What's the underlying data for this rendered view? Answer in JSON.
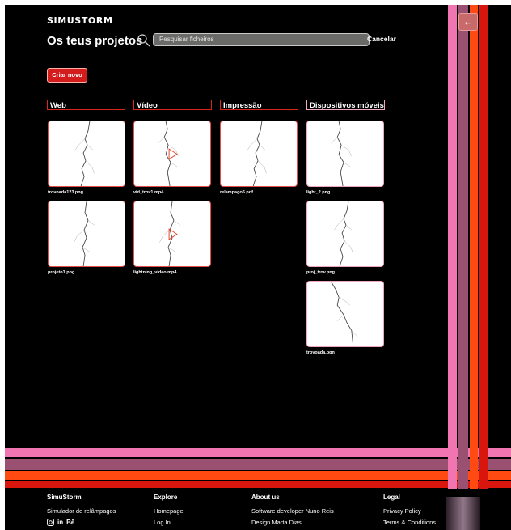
{
  "app": {
    "logo": "SIMUSTORM",
    "title": "Os teus projetos"
  },
  "search": {
    "placeholder": "Pesquisar ficheiros",
    "value": "",
    "cancel": "Cancelar"
  },
  "actions": {
    "create": "Criar novo"
  },
  "columns": [
    {
      "label": "Web",
      "files": [
        "trovoada123.png",
        "projeto1.png"
      ]
    },
    {
      "label": "Vídeo",
      "files": [
        "vid_trov1.mp4",
        "lightning_video.mp4"
      ]
    },
    {
      "label": "Impressão",
      "files": [
        "relampago6.pdf"
      ]
    },
    {
      "label": "Dispositivos móveis",
      "files": [
        "light_2.png",
        "proj_trov.png",
        "trovoada.pgn"
      ]
    }
  ],
  "colors": {
    "accent": "#d31d1d",
    "stripe_pink": "#f175b0",
    "stripe_mauve": "#9a5070",
    "stripe_orange": "#ff4a12",
    "stripe_red": "#d8160e"
  },
  "icons": {
    "search": "search-icon",
    "back": "arrow-left-icon",
    "video": "play-icon"
  },
  "footer": {
    "brand": {
      "title": "SimuStorm",
      "tagline": "Simulador de relâmpagos",
      "social": [
        "instagram-icon",
        "linkedin-icon",
        "behance-icon"
      ]
    },
    "explore": {
      "title": "Explore",
      "links": [
        "Homepage",
        "Log In"
      ]
    },
    "about": {
      "title": "About us",
      "links": [
        "Software developer Nuno Reis",
        "Design Marta Dias"
      ]
    },
    "legal": {
      "title": "Legal",
      "links": [
        "Privacy Policy",
        "Terms & Conditions"
      ]
    }
  }
}
